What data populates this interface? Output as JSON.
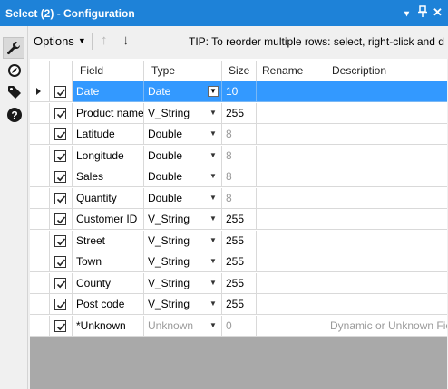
{
  "window": {
    "title": "Select (2) - Configuration",
    "pin_icon": "▾",
    "dock_icon": "⊥",
    "close_icon": "✕"
  },
  "sidebar": {
    "icons": [
      "wrench-icon",
      "compass-icon",
      "tag-icon",
      "help-icon"
    ]
  },
  "toolbar": {
    "options_label": "Options",
    "options_caret": "▼",
    "move_up_label": "↑",
    "move_down_label": "↓",
    "tip": "TIP: To reorder multiple rows: select, right-click and d"
  },
  "grid": {
    "columns": {
      "field": "Field",
      "type": "Type",
      "size": "Size",
      "rename": "Rename",
      "description": "Description"
    },
    "rows": [
      {
        "field": "Date",
        "type": "Date",
        "size": "10",
        "rename": "",
        "description": "",
        "selected": true,
        "muted_size": false
      },
      {
        "field": "Product name",
        "type": "V_String",
        "size": "255",
        "rename": "",
        "description": "",
        "muted_size": false
      },
      {
        "field": "Latitude",
        "type": "Double",
        "size": "8",
        "rename": "",
        "description": "",
        "muted_size": true
      },
      {
        "field": "Longitude",
        "type": "Double",
        "size": "8",
        "rename": "",
        "description": "",
        "muted_size": true
      },
      {
        "field": "Sales",
        "type": "Double",
        "size": "8",
        "rename": "",
        "description": "",
        "muted_size": true
      },
      {
        "field": "Quantity",
        "type": "Double",
        "size": "8",
        "rename": "",
        "description": "",
        "muted_size": true
      },
      {
        "field": "Customer ID",
        "type": "V_String",
        "size": "255",
        "rename": "",
        "description": "",
        "muted_size": false
      },
      {
        "field": "Street",
        "type": "V_String",
        "size": "255",
        "rename": "",
        "description": "",
        "muted_size": false
      },
      {
        "field": "Town",
        "type": "V_String",
        "size": "255",
        "rename": "",
        "description": "",
        "muted_size": false
      },
      {
        "field": "County",
        "type": "V_String",
        "size": "255",
        "rename": "",
        "description": "",
        "muted_size": false
      },
      {
        "field": "Post code",
        "type": "V_String",
        "size": "255",
        "rename": "",
        "description": "",
        "muted_size": false
      },
      {
        "field": "*Unknown",
        "type": "Unknown",
        "size": "0",
        "rename": "",
        "description": "Dynamic or Unknown Fiel",
        "muted_size": true,
        "muted_type": true
      }
    ]
  },
  "colors": {
    "titlebar": "#1e82d8",
    "selection": "#3399ff",
    "empty_area": "#a9a9a9"
  }
}
